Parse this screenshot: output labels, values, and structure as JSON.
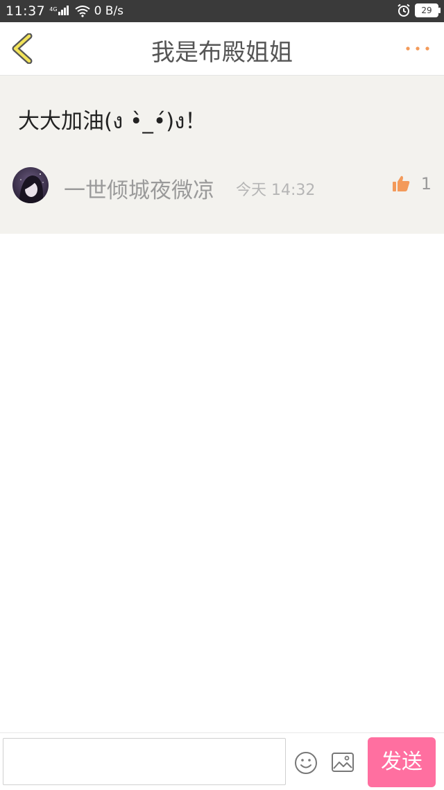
{
  "status_bar": {
    "time": "11:37",
    "network": "4G",
    "speed": "0 B/s",
    "battery": "29"
  },
  "header": {
    "title": "我是布殿姐姐"
  },
  "post": {
    "content": "大大加油(ง •̀_•́)ง！",
    "author": "一世倾城夜微凉",
    "date_label": "今天",
    "time": "14:32",
    "likes": "1"
  },
  "composer": {
    "input_value": "",
    "placeholder": "",
    "send_label": "发送"
  },
  "colors": {
    "accent": "#ff6fa0",
    "like": "#f39a5a",
    "post_bg": "#f3f2ee"
  },
  "icons": {
    "back": "chevron-left-icon",
    "more": "more-dots-icon",
    "like": "thumbs-up-icon",
    "emoji": "smiley-icon",
    "image": "image-icon"
  }
}
